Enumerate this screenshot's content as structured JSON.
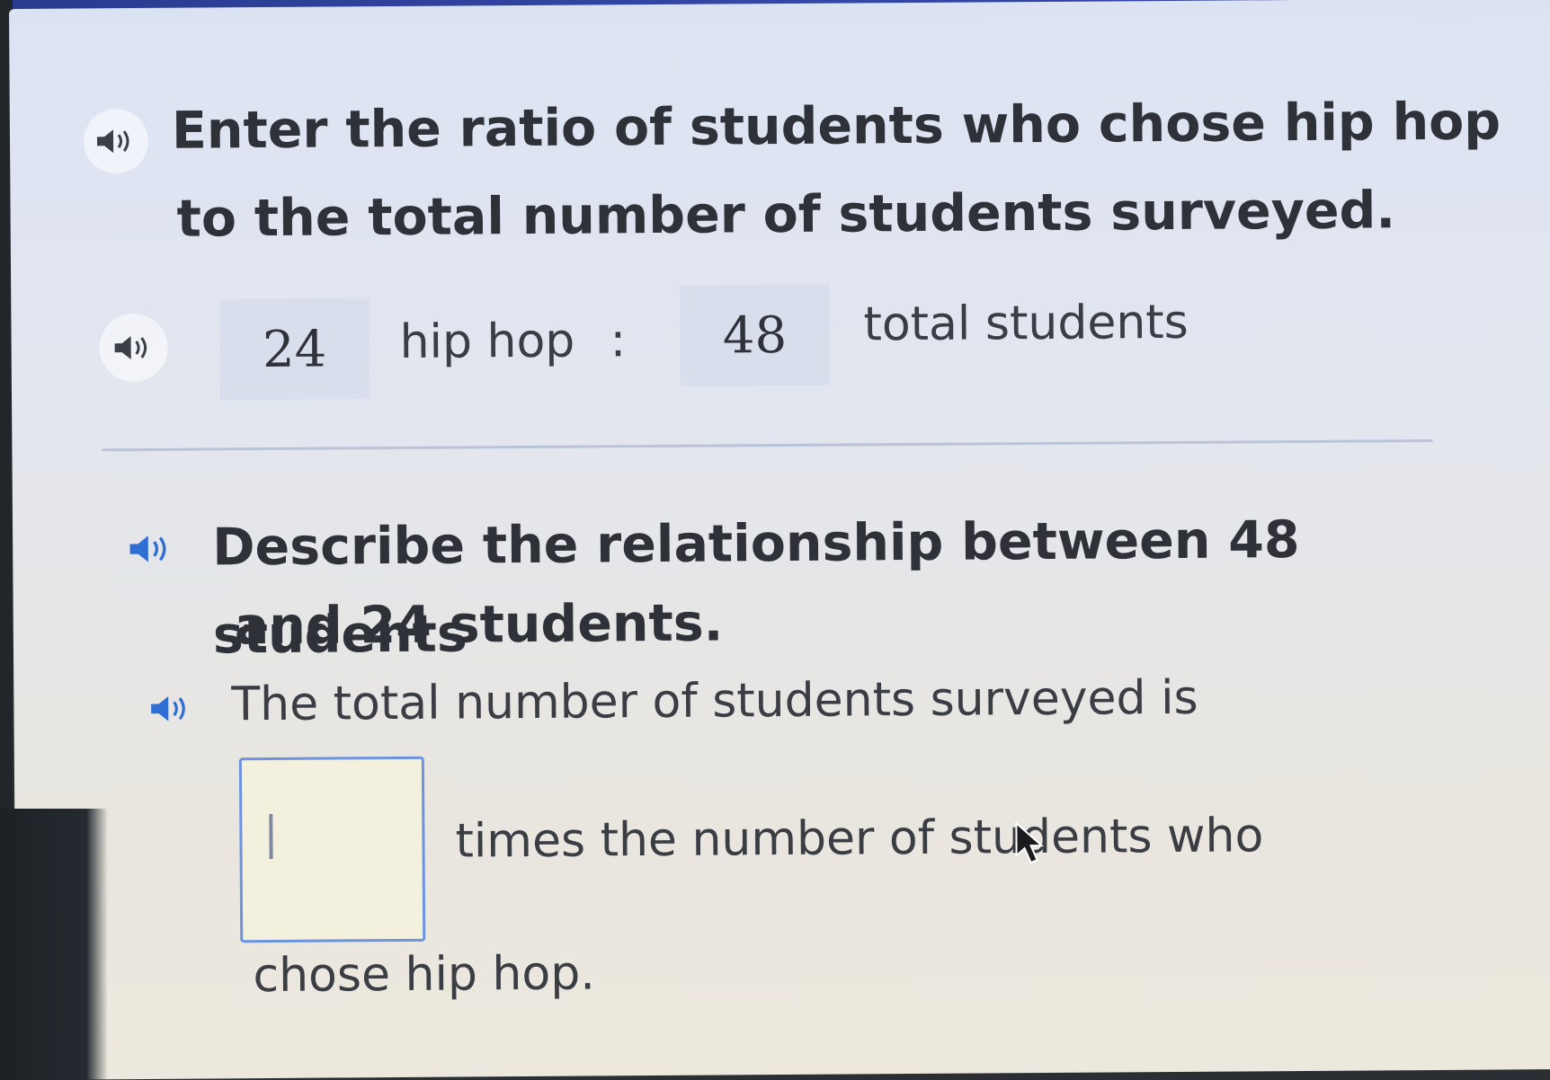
{
  "question1": {
    "line1": "Enter the ratio of students who chose hip hop",
    "line2": "to the total number of students surveyed.",
    "ratio": {
      "first_value": "24",
      "first_label": "hip hop",
      "separator": ":",
      "second_value": "48",
      "second_label": "total students"
    }
  },
  "question2": {
    "line1": "Describe the relationship between 48 students",
    "line2": "and 24 students.",
    "sentence_start": "The total number of students surveyed is",
    "sentence_middle": "times the number of students who",
    "sentence_end": "chose hip hop.",
    "input_value": ""
  },
  "icons": {
    "speaker": "speaker-icon",
    "cursor": "mouse-pointer-icon"
  },
  "colors": {
    "input_border": "#6d93e0",
    "answer_box_bg": "#d8deec",
    "speaker_blue": "#2f6fd4"
  }
}
